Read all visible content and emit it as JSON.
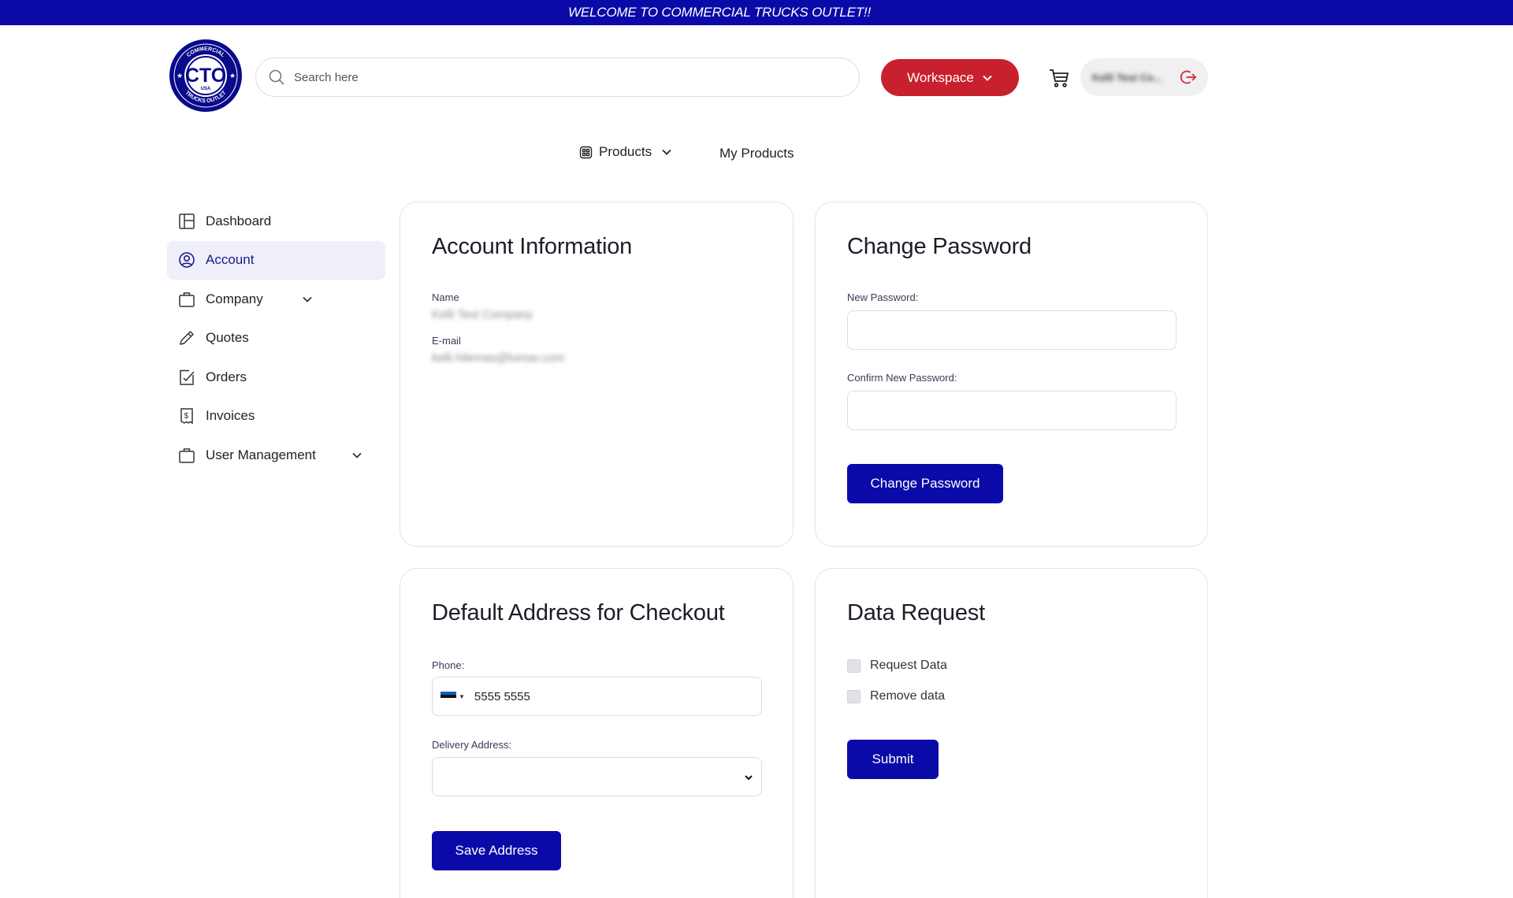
{
  "banner": {
    "text": "WELCOME TO COMMERCIAL TRUCKS OUTLET!!"
  },
  "logo": {
    "top_text": "COMMERCIAL",
    "letters": "CTO",
    "sub_text": "USA",
    "bottom_text": "TRUCKS OUTLET"
  },
  "search": {
    "placeholder": "Search here"
  },
  "header": {
    "workspace_label": "Workspace",
    "user_name": "Kelli Test Co...",
    "icons": [
      "cart-icon",
      "logout-icon"
    ]
  },
  "nav": {
    "products_label": "Products",
    "my_products_label": "My Products"
  },
  "sidebar": {
    "items": [
      {
        "label": "Dashboard",
        "icon": "dashboard-icon"
      },
      {
        "label": "Account",
        "icon": "user-circle-icon",
        "active": true
      },
      {
        "label": "Company",
        "icon": "briefcase-icon",
        "expandable": true
      },
      {
        "label": "Quotes",
        "icon": "pencil-icon"
      },
      {
        "label": "Orders",
        "icon": "orders-icon"
      },
      {
        "label": "Invoices",
        "icon": "invoice-icon"
      },
      {
        "label": "User Management",
        "icon": "briefcase-icon",
        "expandable": true
      }
    ]
  },
  "account_info": {
    "title": "Account Information",
    "name_label": "Name",
    "name_value": "Kelli Test Company",
    "email_label": "E-mail",
    "email_value": "kelli.hilemas@lumav.com"
  },
  "change_password": {
    "title": "Change Password",
    "new_label": "New Password:",
    "confirm_label": "Confirm New Password:",
    "button_label": "Change Password"
  },
  "address": {
    "title": "Default Address for Checkout",
    "phone_label": "Phone:",
    "phone_value": "5555 5555",
    "delivery_label": "Delivery Address:",
    "delivery_value": "",
    "button_label": "Save Address"
  },
  "data_request": {
    "title": "Data Request",
    "option1": "Request Data",
    "option2": "Remove data",
    "button_label": "Submit"
  },
  "colors": {
    "brand_blue": "#0a0aa8",
    "brand_red": "#c8202c",
    "active_bg": "#eeeff9"
  }
}
